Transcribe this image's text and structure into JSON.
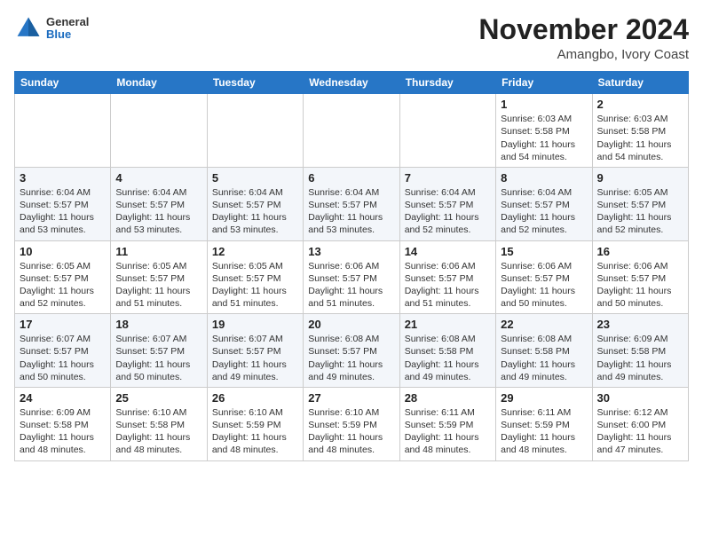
{
  "header": {
    "logo_general": "General",
    "logo_blue": "Blue",
    "month": "November 2024",
    "location": "Amangbo, Ivory Coast"
  },
  "weekdays": [
    "Sunday",
    "Monday",
    "Tuesday",
    "Wednesday",
    "Thursday",
    "Friday",
    "Saturday"
  ],
  "weeks": [
    [
      {
        "day": "",
        "info": ""
      },
      {
        "day": "",
        "info": ""
      },
      {
        "day": "",
        "info": ""
      },
      {
        "day": "",
        "info": ""
      },
      {
        "day": "",
        "info": ""
      },
      {
        "day": "1",
        "info": "Sunrise: 6:03 AM\nSunset: 5:58 PM\nDaylight: 11 hours and 54 minutes."
      },
      {
        "day": "2",
        "info": "Sunrise: 6:03 AM\nSunset: 5:58 PM\nDaylight: 11 hours and 54 minutes."
      }
    ],
    [
      {
        "day": "3",
        "info": "Sunrise: 6:04 AM\nSunset: 5:57 PM\nDaylight: 11 hours and 53 minutes."
      },
      {
        "day": "4",
        "info": "Sunrise: 6:04 AM\nSunset: 5:57 PM\nDaylight: 11 hours and 53 minutes."
      },
      {
        "day": "5",
        "info": "Sunrise: 6:04 AM\nSunset: 5:57 PM\nDaylight: 11 hours and 53 minutes."
      },
      {
        "day": "6",
        "info": "Sunrise: 6:04 AM\nSunset: 5:57 PM\nDaylight: 11 hours and 53 minutes."
      },
      {
        "day": "7",
        "info": "Sunrise: 6:04 AM\nSunset: 5:57 PM\nDaylight: 11 hours and 52 minutes."
      },
      {
        "day": "8",
        "info": "Sunrise: 6:04 AM\nSunset: 5:57 PM\nDaylight: 11 hours and 52 minutes."
      },
      {
        "day": "9",
        "info": "Sunrise: 6:05 AM\nSunset: 5:57 PM\nDaylight: 11 hours and 52 minutes."
      }
    ],
    [
      {
        "day": "10",
        "info": "Sunrise: 6:05 AM\nSunset: 5:57 PM\nDaylight: 11 hours and 52 minutes."
      },
      {
        "day": "11",
        "info": "Sunrise: 6:05 AM\nSunset: 5:57 PM\nDaylight: 11 hours and 51 minutes."
      },
      {
        "day": "12",
        "info": "Sunrise: 6:05 AM\nSunset: 5:57 PM\nDaylight: 11 hours and 51 minutes."
      },
      {
        "day": "13",
        "info": "Sunrise: 6:06 AM\nSunset: 5:57 PM\nDaylight: 11 hours and 51 minutes."
      },
      {
        "day": "14",
        "info": "Sunrise: 6:06 AM\nSunset: 5:57 PM\nDaylight: 11 hours and 51 minutes."
      },
      {
        "day": "15",
        "info": "Sunrise: 6:06 AM\nSunset: 5:57 PM\nDaylight: 11 hours and 50 minutes."
      },
      {
        "day": "16",
        "info": "Sunrise: 6:06 AM\nSunset: 5:57 PM\nDaylight: 11 hours and 50 minutes."
      }
    ],
    [
      {
        "day": "17",
        "info": "Sunrise: 6:07 AM\nSunset: 5:57 PM\nDaylight: 11 hours and 50 minutes."
      },
      {
        "day": "18",
        "info": "Sunrise: 6:07 AM\nSunset: 5:57 PM\nDaylight: 11 hours and 50 minutes."
      },
      {
        "day": "19",
        "info": "Sunrise: 6:07 AM\nSunset: 5:57 PM\nDaylight: 11 hours and 49 minutes."
      },
      {
        "day": "20",
        "info": "Sunrise: 6:08 AM\nSunset: 5:57 PM\nDaylight: 11 hours and 49 minutes."
      },
      {
        "day": "21",
        "info": "Sunrise: 6:08 AM\nSunset: 5:58 PM\nDaylight: 11 hours and 49 minutes."
      },
      {
        "day": "22",
        "info": "Sunrise: 6:08 AM\nSunset: 5:58 PM\nDaylight: 11 hours and 49 minutes."
      },
      {
        "day": "23",
        "info": "Sunrise: 6:09 AM\nSunset: 5:58 PM\nDaylight: 11 hours and 49 minutes."
      }
    ],
    [
      {
        "day": "24",
        "info": "Sunrise: 6:09 AM\nSunset: 5:58 PM\nDaylight: 11 hours and 48 minutes."
      },
      {
        "day": "25",
        "info": "Sunrise: 6:10 AM\nSunset: 5:58 PM\nDaylight: 11 hours and 48 minutes."
      },
      {
        "day": "26",
        "info": "Sunrise: 6:10 AM\nSunset: 5:59 PM\nDaylight: 11 hours and 48 minutes."
      },
      {
        "day": "27",
        "info": "Sunrise: 6:10 AM\nSunset: 5:59 PM\nDaylight: 11 hours and 48 minutes."
      },
      {
        "day": "28",
        "info": "Sunrise: 6:11 AM\nSunset: 5:59 PM\nDaylight: 11 hours and 48 minutes."
      },
      {
        "day": "29",
        "info": "Sunrise: 6:11 AM\nSunset: 5:59 PM\nDaylight: 11 hours and 48 minutes."
      },
      {
        "day": "30",
        "info": "Sunrise: 6:12 AM\nSunset: 6:00 PM\nDaylight: 11 hours and 47 minutes."
      }
    ]
  ]
}
